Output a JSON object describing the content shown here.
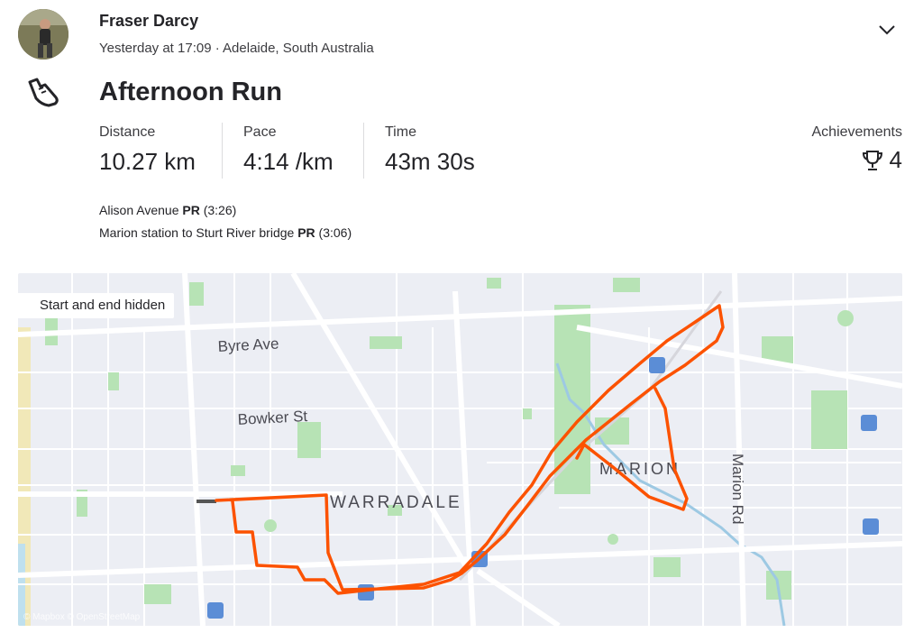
{
  "athlete": {
    "name": "Fraser Darcy",
    "meta": "Yesterday at 17:09 · Adelaide, South Australia"
  },
  "activity": {
    "title": "Afternoon Run",
    "icon": "shoe-icon"
  },
  "stats": {
    "distance_label": "Distance",
    "distance_value": "10.27 km",
    "pace_label": "Pace",
    "pace_value": "4:14 /km",
    "time_label": "Time",
    "time_value": "43m 30s",
    "achievements_label": "Achievements",
    "achievements_value": "4"
  },
  "segments": [
    {
      "name": "Alison Avenue ",
      "pr": "PR",
      "time": " (3:26)"
    },
    {
      "name": "Marion station to Sturt River bridge ",
      "pr": "PR",
      "time": " (3:06)"
    }
  ],
  "map": {
    "badge": "Start and end hidden",
    "labels": {
      "byre": "Byre Ave",
      "bowker": "Bowker St",
      "warradale": "WARRADALE",
      "marion": "MARION",
      "marion_rd": "Marion Rd"
    },
    "attribution": "© Mapbox © OpenStreetMap",
    "route_color": "#fc5200",
    "water_color": "#9dc9e3",
    "park_color": "#b7e3b5"
  }
}
